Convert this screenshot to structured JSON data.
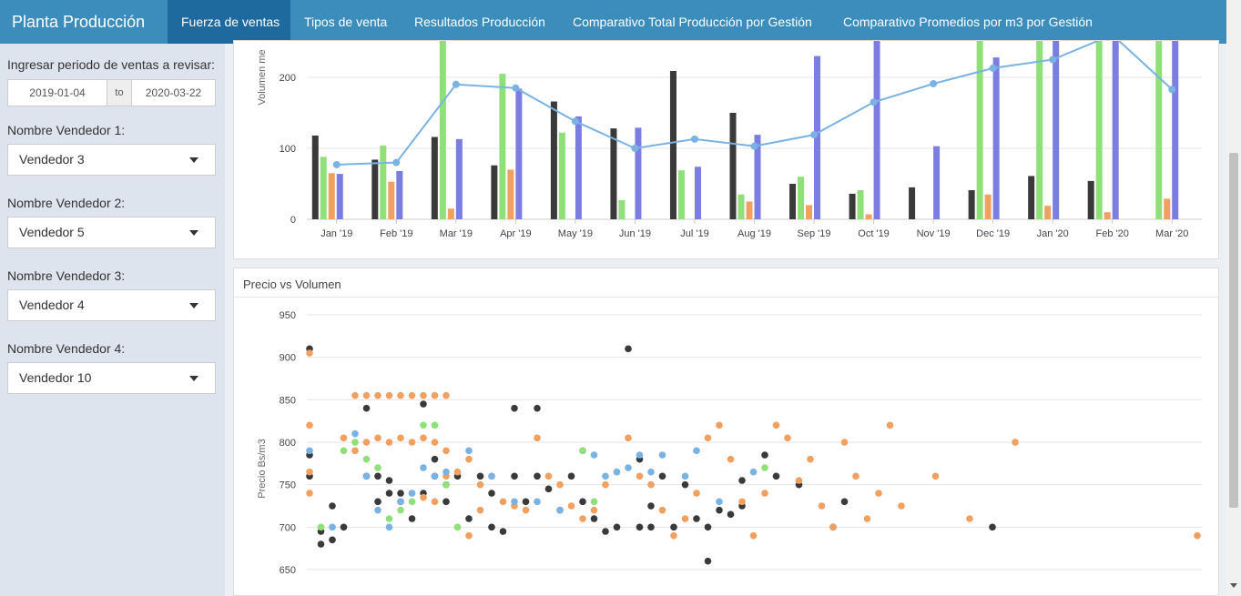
{
  "app": {
    "title": "Planta Producción"
  },
  "tabs": [
    {
      "label": "Fuerza de ventas",
      "active": true
    },
    {
      "label": "Tipos de venta"
    },
    {
      "label": "Resultados Producción"
    },
    {
      "label": "Comparativo Total Producción por Gestión"
    },
    {
      "label": "Comparativo Promedios por m3 por Gestión"
    }
  ],
  "sidebar": {
    "period_label": "Ingresar periodo de ventas a revisar:",
    "date_start": "2019-01-04",
    "date_sep": "to",
    "date_end": "2020-03-22",
    "vendors": [
      {
        "label": "Nombre Vendedor 1:",
        "value": "Vendedor 3"
      },
      {
        "label": "Nombre Vendedor 2:",
        "value": "Vendedor 5"
      },
      {
        "label": "Nombre Vendedor 3:",
        "value": "Vendedor 4"
      },
      {
        "label": "Nombre Vendedor 4:",
        "value": "Vendedor 10"
      }
    ]
  },
  "colors": {
    "navbar": "#3c8dbc",
    "active_tab": "#1e6a9e",
    "sidebar": "#dde4ee",
    "dark": "#3a3a3a",
    "green": "#90e07a",
    "orange": "#f0a060",
    "blue": "#7b7de0",
    "line": "#7ab3e3"
  },
  "chart_data": [
    {
      "type": "bar",
      "ylabel": "Volumen me",
      "yticks": [
        0,
        100,
        200
      ],
      "categories": [
        "Jan '19",
        "Feb '19",
        "Mar '19",
        "Apr '19",
        "May '19",
        "Jun '19",
        "Jul '19",
        "Aug '19",
        "Sep '19",
        "Oct '19",
        "Nov '19",
        "Dec '19",
        "Jan '20",
        "Feb '20",
        "Mar '20"
      ],
      "series": [
        {
          "color": "#3a3a3a",
          "values": [
            118,
            84,
            116,
            76,
            166,
            128,
            209,
            150,
            50,
            36,
            45,
            41,
            61,
            54,
            0
          ]
        },
        {
          "color": "#90e07a",
          "values": [
            88,
            104,
            255,
            205,
            122,
            27,
            69,
            35,
            60,
            41,
            0,
            255,
            255,
            255,
            255
          ]
        },
        {
          "color": "#f0a060",
          "values": [
            65,
            53,
            15,
            70,
            0,
            0,
            0,
            25,
            20,
            7,
            0,
            35,
            19,
            10,
            29
          ]
        },
        {
          "color": "#7b7de0",
          "values": [
            64,
            68,
            113,
            184,
            145,
            129,
            74,
            119,
            230,
            255,
            103,
            228,
            255,
            255,
            255
          ]
        },
        {
          "type": "line",
          "color": "#7ab3e3",
          "values": [
            77,
            80,
            190,
            185,
            138,
            100,
            113,
            103,
            119,
            165,
            191,
            213,
            225,
            260,
            183
          ]
        }
      ]
    },
    {
      "type": "scatter",
      "title": "Precio vs Volumen",
      "ylabel": "Precio Bs/m3",
      "yticks": [
        650,
        700,
        750,
        800,
        850,
        900,
        950
      ],
      "series": [
        {
          "color": "#3a3a3a",
          "points": [
            [
              0,
              910
            ],
            [
              0,
              785
            ],
            [
              0,
              760
            ],
            [
              1,
              695
            ],
            [
              1,
              680
            ],
            [
              2,
              725
            ],
            [
              2,
              685
            ],
            [
              3,
              700
            ],
            [
              5,
              840
            ],
            [
              5,
              760
            ],
            [
              6,
              760
            ],
            [
              6,
              730
            ],
            [
              7,
              755
            ],
            [
              7,
              740
            ],
            [
              8,
              730
            ],
            [
              8,
              740
            ],
            [
              9,
              710
            ],
            [
              10,
              845
            ],
            [
              10,
              740
            ],
            [
              11,
              780
            ],
            [
              11,
              760
            ],
            [
              12,
              730
            ],
            [
              12,
              750
            ],
            [
              13,
              760
            ],
            [
              14,
              710
            ],
            [
              15,
              760
            ],
            [
              16,
              740
            ],
            [
              16,
              700
            ],
            [
              17,
              695
            ],
            [
              18,
              840
            ],
            [
              18,
              760
            ],
            [
              19,
              730
            ],
            [
              20,
              840
            ],
            [
              20,
              760
            ],
            [
              21,
              745
            ],
            [
              22,
              720
            ],
            [
              23,
              760
            ],
            [
              24,
              730
            ],
            [
              25,
              710
            ],
            [
              26,
              695
            ],
            [
              27,
              700
            ],
            [
              28,
              910
            ],
            [
              29,
              700
            ],
            [
              29,
              780
            ],
            [
              30,
              725
            ],
            [
              30,
              700
            ],
            [
              31,
              760
            ],
            [
              32,
              700
            ],
            [
              33,
              750
            ],
            [
              34,
              710
            ],
            [
              35,
              660
            ],
            [
              35,
              700
            ],
            [
              36,
              720
            ],
            [
              37,
              715
            ],
            [
              38,
              755
            ],
            [
              38,
              725
            ],
            [
              40,
              785
            ],
            [
              41,
              760
            ],
            [
              43,
              750
            ],
            [
              46,
              700
            ],
            [
              47,
              730
            ],
            [
              60,
              700
            ]
          ]
        },
        {
          "color": "#f0a060",
          "points": [
            [
              0,
              905
            ],
            [
              0,
              820
            ],
            [
              0,
              765
            ],
            [
              0,
              740
            ],
            [
              4,
              855
            ],
            [
              5,
              855
            ],
            [
              6,
              855
            ],
            [
              7,
              855
            ],
            [
              8,
              855
            ],
            [
              9,
              855
            ],
            [
              10,
              855
            ],
            [
              11,
              855
            ],
            [
              12,
              855
            ],
            [
              3,
              805
            ],
            [
              4,
              790
            ],
            [
              5,
              800
            ],
            [
              6,
              805
            ],
            [
              7,
              800
            ],
            [
              8,
              805
            ],
            [
              9,
              800
            ],
            [
              10,
              805
            ],
            [
              11,
              800
            ],
            [
              12,
              790
            ],
            [
              13,
              765
            ],
            [
              14,
              780
            ],
            [
              15,
              750
            ],
            [
              16,
              760
            ],
            [
              17,
              730
            ],
            [
              18,
              725
            ],
            [
              19,
              720
            ],
            [
              20,
              805
            ],
            [
              21,
              760
            ],
            [
              22,
              750
            ],
            [
              23,
              725
            ],
            [
              24,
              710
            ],
            [
              25,
              720
            ],
            [
              26,
              750
            ],
            [
              27,
              765
            ],
            [
              28,
              805
            ],
            [
              29,
              760
            ],
            [
              30,
              750
            ],
            [
              31,
              720
            ],
            [
              32,
              690
            ],
            [
              33,
              710
            ],
            [
              34,
              740
            ],
            [
              35,
              805
            ],
            [
              36,
              820
            ],
            [
              37,
              780
            ],
            [
              38,
              730
            ],
            [
              39,
              690
            ],
            [
              40,
              740
            ],
            [
              41,
              820
            ],
            [
              42,
              805
            ],
            [
              43,
              755
            ],
            [
              44,
              780
            ],
            [
              45,
              725
            ],
            [
              46,
              700
            ],
            [
              47,
              800
            ],
            [
              48,
              760
            ],
            [
              49,
              710
            ],
            [
              50,
              740
            ],
            [
              51,
              820
            ],
            [
              52,
              725
            ],
            [
              55,
              760
            ],
            [
              58,
              710
            ],
            [
              62,
              800
            ],
            [
              78,
              690
            ],
            [
              9,
              740
            ],
            [
              10,
              735
            ],
            [
              11,
              730
            ],
            [
              12,
              760
            ],
            [
              13,
              700
            ],
            [
              14,
              690
            ],
            [
              15,
              720
            ]
          ]
        },
        {
          "color": "#7ab3e3",
          "points": [
            [
              0,
              790
            ],
            [
              2,
              700
            ],
            [
              4,
              810
            ],
            [
              5,
              760
            ],
            [
              6,
              720
            ],
            [
              7,
              700
            ],
            [
              8,
              730
            ],
            [
              9,
              740
            ],
            [
              10,
              770
            ],
            [
              11,
              760
            ],
            [
              12,
              765
            ],
            [
              14,
              790
            ],
            [
              16,
              760
            ],
            [
              18,
              730
            ],
            [
              20,
              730
            ],
            [
              22,
              720
            ],
            [
              24,
              790
            ],
            [
              25,
              785
            ],
            [
              26,
              760
            ],
            [
              27,
              765
            ],
            [
              28,
              770
            ],
            [
              29,
              785
            ],
            [
              30,
              765
            ],
            [
              31,
              785
            ],
            [
              33,
              760
            ],
            [
              34,
              790
            ],
            [
              36,
              730
            ],
            [
              39,
              765
            ]
          ]
        },
        {
          "color": "#90e07a",
          "points": [
            [
              1,
              700
            ],
            [
              3,
              790
            ],
            [
              4,
              800
            ],
            [
              5,
              780
            ],
            [
              6,
              770
            ],
            [
              7,
              710
            ],
            [
              8,
              720
            ],
            [
              9,
              730
            ],
            [
              10,
              820
            ],
            [
              11,
              820
            ],
            [
              12,
              750
            ],
            [
              13,
              700
            ],
            [
              24,
              790
            ],
            [
              25,
              730
            ],
            [
              40,
              770
            ]
          ]
        }
      ]
    }
  ]
}
